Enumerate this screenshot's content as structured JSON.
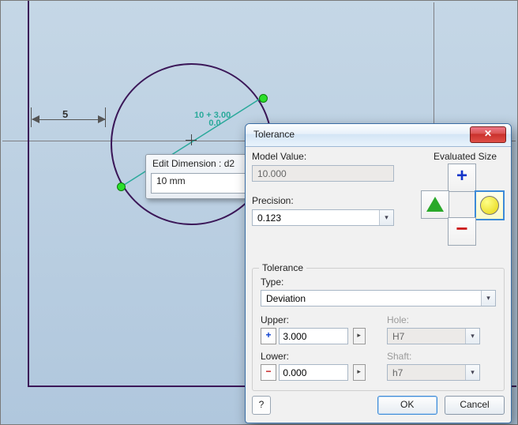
{
  "sketch": {
    "dim5_label": "5",
    "edit_popup": {
      "title": "Edit Dimension : d2",
      "value": "10 mm"
    },
    "active_dim_text": "10 + 3.00\n      0.0"
  },
  "dialog": {
    "title": "Tolerance",
    "close_glyph": "✕",
    "model_value": {
      "label": "Model Value:",
      "value": "10.000"
    },
    "evaluated_label": "Evaluated Size",
    "precision": {
      "label": "Precision:",
      "value": "0.123"
    },
    "tolerance_group": {
      "title": "Tolerance",
      "type_label": "Type:",
      "type_value": "Deviation",
      "upper_label": "Upper:",
      "upper_value": "3.000",
      "lower_label": "Lower:",
      "lower_value": "0.000",
      "hole_label": "Hole:",
      "hole_value": "H7",
      "shaft_label": "Shaft:",
      "shaft_value": "h7"
    },
    "buttons": {
      "help_glyph": "?",
      "ok": "OK",
      "cancel": "Cancel"
    }
  }
}
